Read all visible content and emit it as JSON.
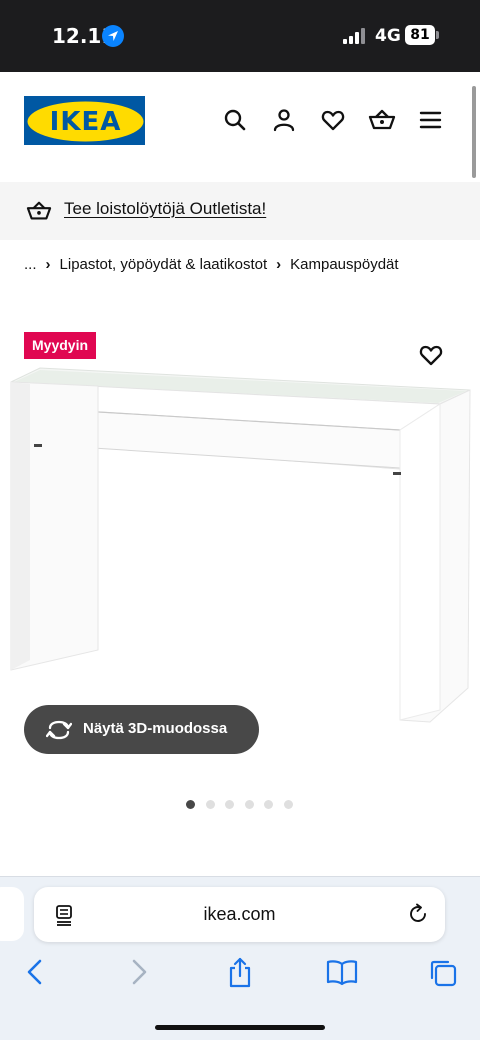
{
  "status_bar": {
    "time": "12.11",
    "network": "4G",
    "battery": "81"
  },
  "header": {
    "logo_text": "IKEA",
    "icons": [
      "search-icon",
      "user-icon",
      "heart-icon",
      "shopping-basket-icon",
      "menu-icon"
    ]
  },
  "colors": {
    "brand_blue": "#0058a3",
    "brand_yellow": "#ffdb00",
    "badge_red": "#e00751",
    "button_dark": "#484848"
  },
  "outlet_banner": {
    "text": "Tee loistolöytöjä Outletista!"
  },
  "breadcrumb": {
    "items": [
      "...",
      "Lipastot, yöpöydät & laatikostot",
      "Kampauspöydät"
    ]
  },
  "product": {
    "badge": "Myydyin",
    "view_3d_label": "Näytä 3D-muodossa",
    "gallery_total": 6,
    "gallery_active": 1
  },
  "browser": {
    "url": "ikea.com"
  }
}
